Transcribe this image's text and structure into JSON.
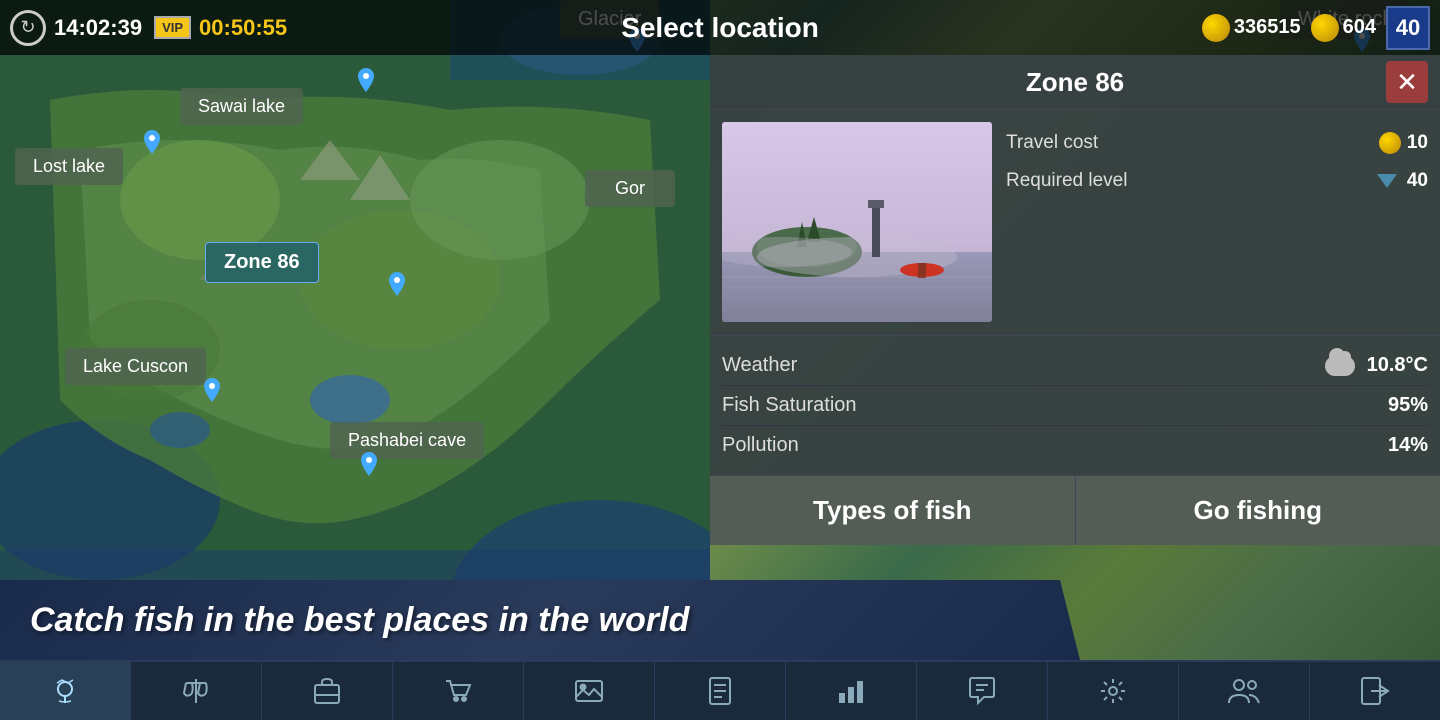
{
  "topbar": {
    "time": "14:02:39",
    "vip_label": "VIP",
    "countdown": "00:50:55",
    "select_location": "Select location",
    "silver_currency": "336515",
    "gold_currency": "604",
    "player_level": "40"
  },
  "map": {
    "locations": [
      {
        "id": "sawai",
        "label": "Sawai lake",
        "active": false
      },
      {
        "id": "lost",
        "label": "Lost lake",
        "active": false
      },
      {
        "id": "zone86",
        "label": "Zone 86",
        "active": true
      },
      {
        "id": "cuscon",
        "label": "Lake Cuscon",
        "active": false
      },
      {
        "id": "pashabei",
        "label": "Pashabei cave",
        "active": false
      },
      {
        "id": "gor",
        "label": "Gor",
        "active": false
      },
      {
        "id": "glacier",
        "label": "Glacier",
        "active": false
      }
    ]
  },
  "zone_panel": {
    "title": "Zone 86",
    "close_label": "✕",
    "travel_cost_label": "Travel cost",
    "travel_cost_value": "10",
    "required_level_label": "Required level",
    "required_level_value": "40",
    "weather_label": "Weather",
    "weather_temp": "10.8°C",
    "fish_saturation_label": "Fish Saturation",
    "fish_saturation_value": "95%",
    "pollution_label": "Pollution",
    "pollution_value": "14%",
    "btn_types_of_fish": "Types of fish",
    "btn_go_fishing": "Go fishing"
  },
  "bottom_banner": {
    "text": "Catch fish in the best places in the world"
  },
  "bottom_nav": {
    "items": [
      {
        "id": "map",
        "icon": "🗺",
        "active": true
      },
      {
        "id": "balance",
        "icon": "⚖"
      },
      {
        "id": "gear",
        "icon": "💼"
      },
      {
        "id": "shop",
        "icon": "🛒"
      },
      {
        "id": "gallery",
        "icon": "🖼"
      },
      {
        "id": "tasks",
        "icon": "📋"
      },
      {
        "id": "stats",
        "icon": "📊"
      },
      {
        "id": "chat",
        "icon": "💬"
      },
      {
        "id": "settings",
        "icon": "⚙"
      },
      {
        "id": "friends",
        "icon": "👥"
      },
      {
        "id": "exit",
        "icon": "🚪"
      }
    ]
  }
}
